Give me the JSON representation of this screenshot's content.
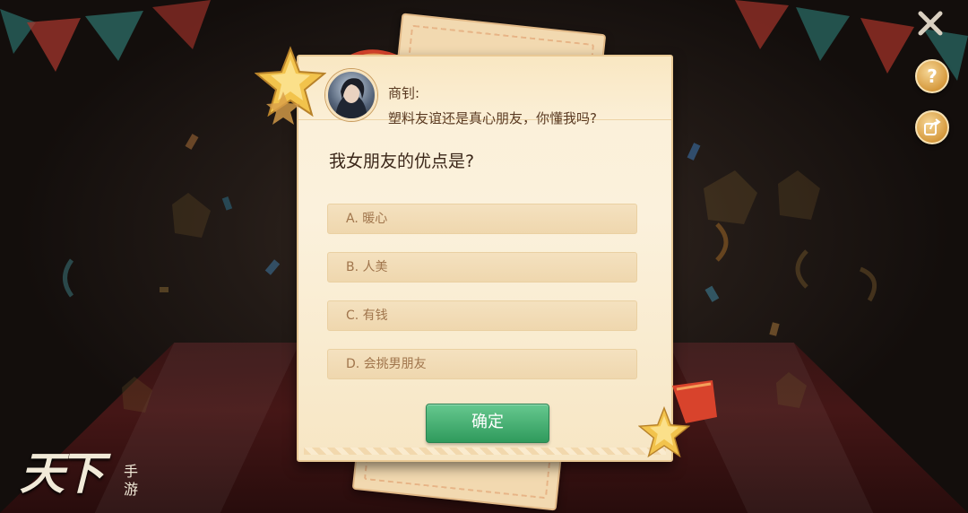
{
  "dialog": {
    "speaker": "商钊:",
    "line": "塑料友谊还是真心朋友，你懂我吗?",
    "question": "我女朋友的优点是?",
    "options": [
      {
        "label": "A. 暖心"
      },
      {
        "label": "B. 人美"
      },
      {
        "label": "C. 有钱"
      },
      {
        "label": "D. 会挑男朋友"
      }
    ],
    "confirm_label": "确定"
  },
  "side_buttons": {
    "help_label": "?"
  },
  "logo": {
    "main": "天下",
    "sub": "手游"
  },
  "colors": {
    "panel": "#fbf0d8",
    "confirm": "#3fae6e",
    "option_text": "#a0754c",
    "side_button": "#d69a3e"
  },
  "icons": [
    "close-icon",
    "help-icon",
    "share-icon",
    "star-icon",
    "ribbon-icon"
  ]
}
